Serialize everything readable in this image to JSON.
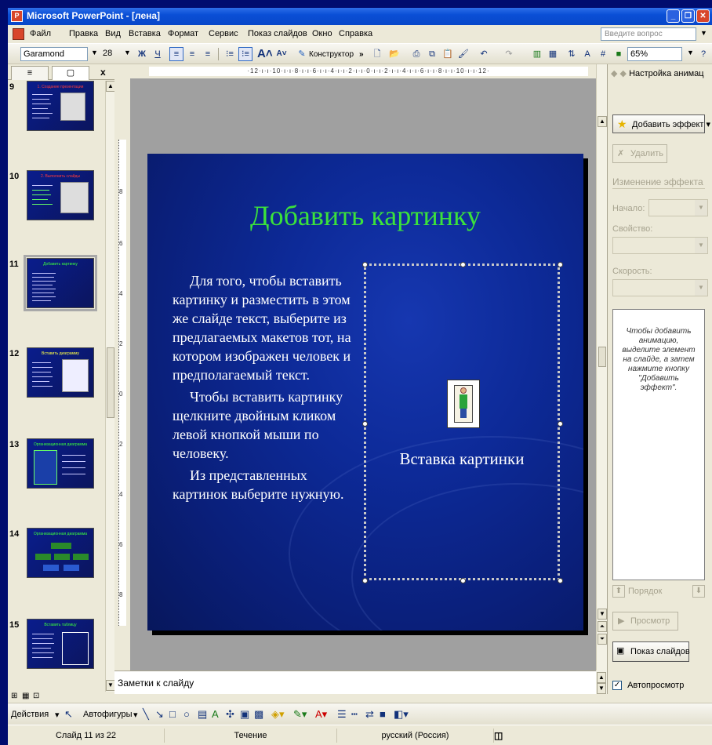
{
  "window": {
    "title": "Microsoft PowerPoint - [лена]"
  },
  "menu": {
    "items": [
      "Файл",
      "Правка",
      "Вид",
      "Вставка",
      "Формат",
      "Сервис",
      "Показ слайдов",
      "Окно",
      "Справка"
    ],
    "help_placeholder": "Введите вопрос"
  },
  "toolbar": {
    "font_name": "Garamond",
    "font_size": "28",
    "bold": "Ж",
    "underline": "Ч",
    "designer_label": "Конструктор",
    "zoom": "65%"
  },
  "left_panel": {
    "tab_outline": "≡",
    "tab_slides": "▢",
    "close": "x",
    "thumbnails": [
      {
        "number": "9",
        "title": "1. Создание презентации"
      },
      {
        "number": "10",
        "title": "2. Выполнить слайды"
      },
      {
        "number": "11",
        "title": "Добавить картинку",
        "selected": true
      },
      {
        "number": "12",
        "title": "Вставить диаграмму"
      },
      {
        "number": "13",
        "title": "Организационная диаграмма"
      },
      {
        "number": "14",
        "title": "Организационная диаграмма"
      },
      {
        "number": "15",
        "title": "Вставить таблицу"
      }
    ]
  },
  "slide": {
    "title": "Добавить картинку",
    "paragraphs": [
      "Для того, чтобы вставить картинку и разместить в этом же слайде текст, выберите из предлагаемых макетов тот,  на котором изображен человек и предполагаемый текст.",
      "Чтобы вставить картинку щелкните двойным кликом левой кнопкой мыши по человеку.",
      "Из представленных картинок выберите нужную."
    ],
    "placeholder_label": "Вставка картинки"
  },
  "notes": {
    "placeholder": "Заметки к слайду"
  },
  "task_pane": {
    "title": "Настройка анимац",
    "add_effect": "Добавить эффект",
    "delete": "Удалить",
    "change_effect": "Изменение эффекта",
    "start_label": "Начало:",
    "property_label": "Свойство:",
    "speed_label": "Скорость:",
    "hint": "Чтобы добавить анимацию, выделите элемент на слайде, а затем нажмите кнопку \"Добавить эффект\".",
    "order_label": "Порядок",
    "preview_label": "Просмотр",
    "slideshow_label": "Показ слайдов",
    "autopreview_label": "Автопросмотр",
    "autopreview_checked": true
  },
  "drawing_toolbar": {
    "actions_label": "Действия",
    "autoshapes_label": "Автофигуры"
  },
  "status_bar": {
    "slide_info": "Слайд 11 из 22",
    "design": "Течение",
    "language": "русский (Россия)"
  },
  "colors": {
    "title_bar": "#0a4fd6",
    "slide_bg": "#0d2a98",
    "slide_title": "#3be23b"
  }
}
